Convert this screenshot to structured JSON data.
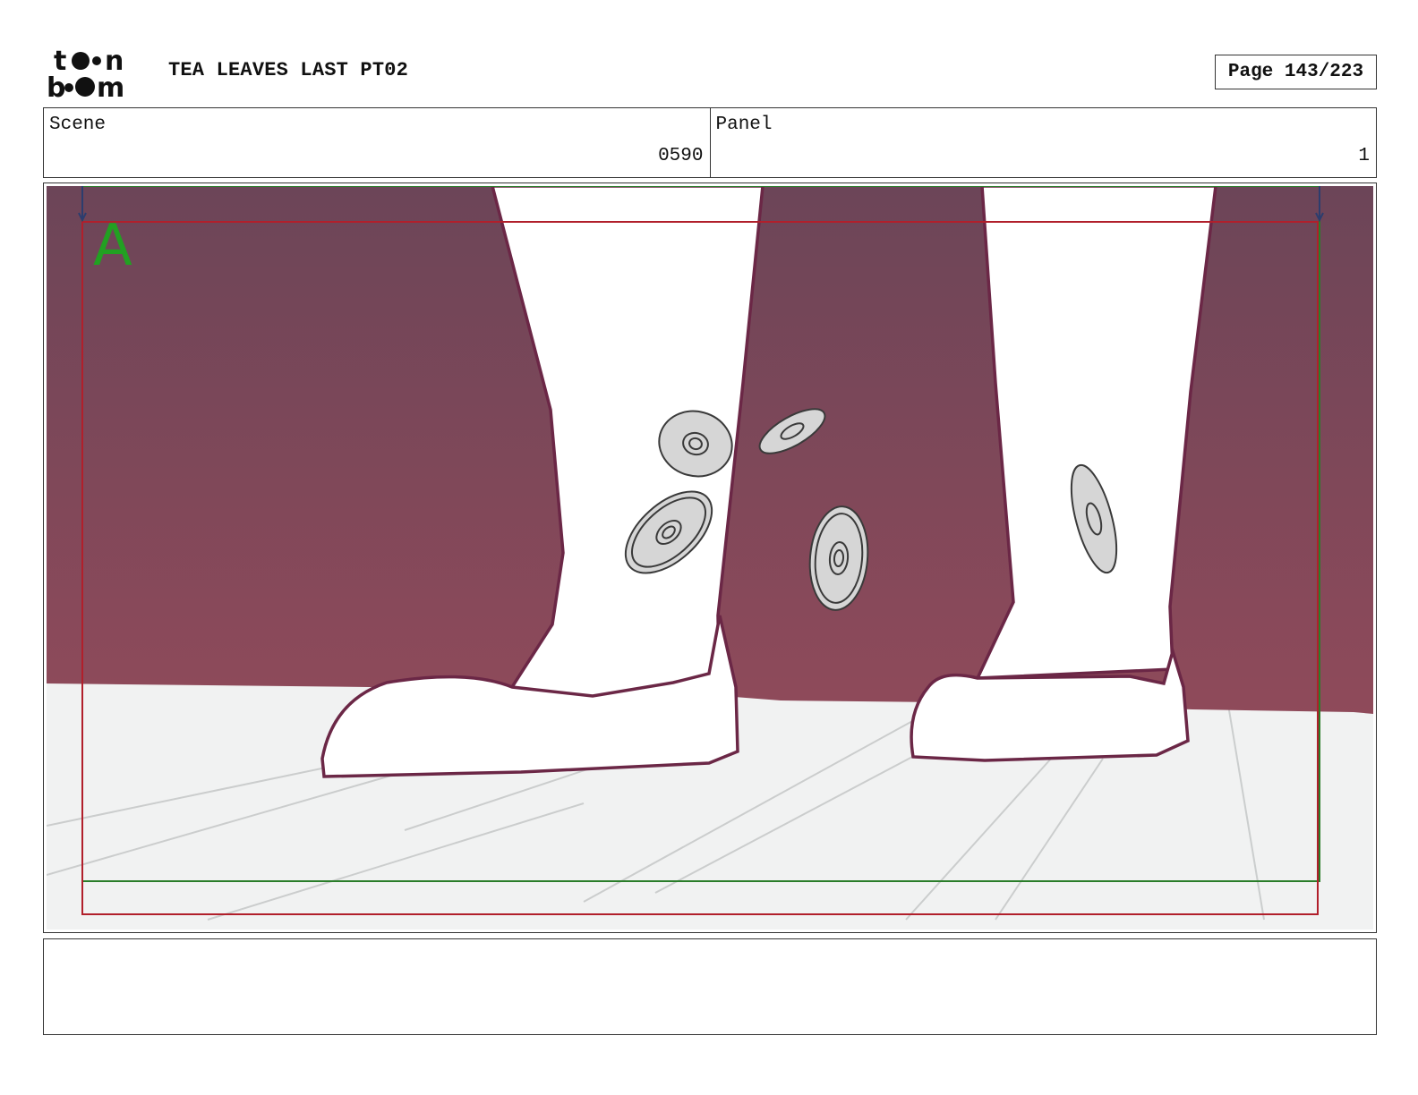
{
  "header": {
    "logo": {
      "name": "toonboom-logo",
      "text": "toon boom"
    },
    "title": "TEA LEAVES LAST PT02",
    "page_label": "Page 143/223"
  },
  "info": {
    "scene_label": "Scene",
    "scene_value": "0590",
    "panel_label": "Panel",
    "panel_value": "1"
  },
  "panel": {
    "layer_marker": "A",
    "colors": {
      "wall_top": "#6c4558",
      "wall_bottom": "#8f4a5a",
      "floor": "#f1f2f2",
      "outline": "#6b2746",
      "safe_frame": "#2a7d2a",
      "camera_frame": "#b11f2b",
      "coin_fill": "#d6d6d6"
    }
  },
  "dialogue": ""
}
